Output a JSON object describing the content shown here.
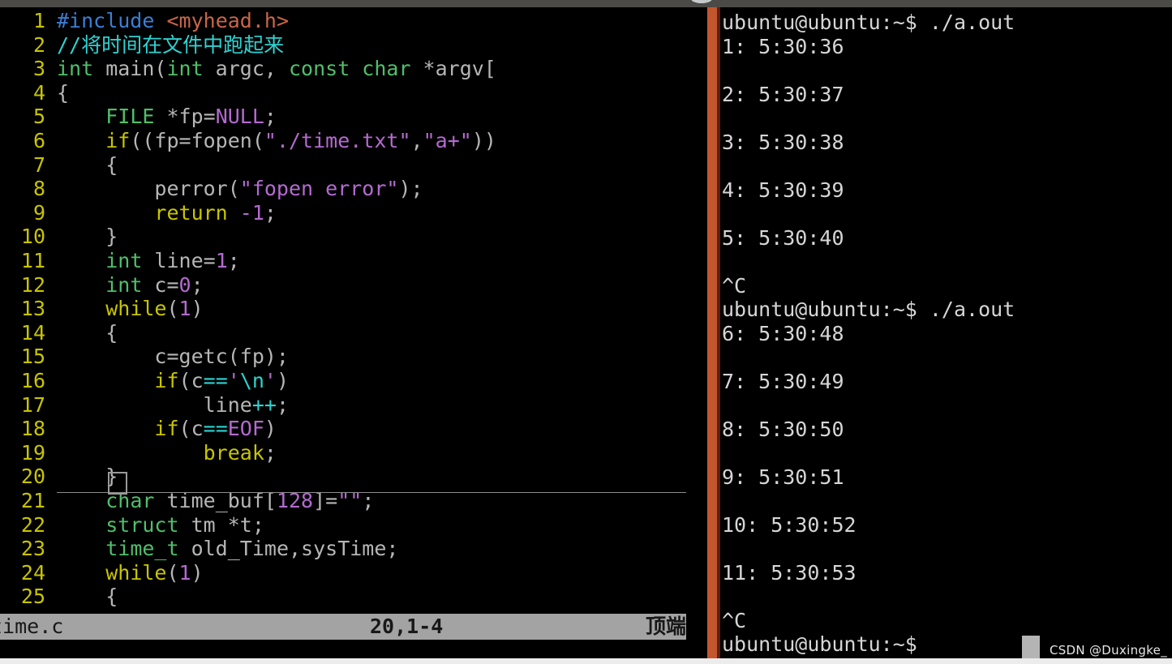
{
  "window": {
    "titlebar_color": "#4c4a46",
    "divider_color": "#c4562e",
    "background": "#000000"
  },
  "editor": {
    "app": "vim",
    "filename": "time.c",
    "cursor_line": 20,
    "cursor_column_display": "20,1-4",
    "scroll_position_label": "顶端",
    "first_visible_line": 1,
    "last_visible_line": 25,
    "lines": [
      {
        "n": "1",
        "tokens": [
          {
            "t": "#include",
            "c": "c-pre"
          },
          {
            "t": " ",
            "c": "c-plain"
          },
          {
            "t": "<myhead.h>",
            "c": "c-inc"
          }
        ]
      },
      {
        "n": "2",
        "tokens": [
          {
            "t": "//将时间在文件中跑起来",
            "c": "c-cmt"
          }
        ]
      },
      {
        "n": "3",
        "tokens": [
          {
            "t": "int",
            "c": "c-type"
          },
          {
            "t": " main(",
            "c": "c-plain"
          },
          {
            "t": "int",
            "c": "c-type"
          },
          {
            "t": " argc, ",
            "c": "c-plain"
          },
          {
            "t": "const char",
            "c": "c-type"
          },
          {
            "t": " *argv[",
            "c": "c-plain"
          }
        ]
      },
      {
        "n": "4",
        "tokens": [
          {
            "t": "{",
            "c": "c-plain"
          }
        ]
      },
      {
        "n": "5",
        "tokens": [
          {
            "t": "    ",
            "c": "c-plain"
          },
          {
            "t": "FILE",
            "c": "c-type"
          },
          {
            "t": " *fp=",
            "c": "c-plain"
          },
          {
            "t": "NULL",
            "c": "c-cnst"
          },
          {
            "t": ";",
            "c": "c-plain"
          }
        ]
      },
      {
        "n": "6",
        "tokens": [
          {
            "t": "    ",
            "c": "c-plain"
          },
          {
            "t": "if",
            "c": "c-kw"
          },
          {
            "t": "((fp=fopen(",
            "c": "c-plain"
          },
          {
            "t": "\"./time.txt\"",
            "c": "c-str"
          },
          {
            "t": ",",
            "c": "c-plain"
          },
          {
            "t": "\"a+\"",
            "c": "c-str"
          },
          {
            "t": "))",
            "c": "c-plain"
          }
        ]
      },
      {
        "n": "7",
        "tokens": [
          {
            "t": "    {",
            "c": "c-plain"
          }
        ]
      },
      {
        "n": "8",
        "tokens": [
          {
            "t": "        perror(",
            "c": "c-plain"
          },
          {
            "t": "\"fopen error\"",
            "c": "c-str"
          },
          {
            "t": ");",
            "c": "c-plain"
          }
        ]
      },
      {
        "n": "9",
        "tokens": [
          {
            "t": "        ",
            "c": "c-plain"
          },
          {
            "t": "return",
            "c": "c-kw"
          },
          {
            "t": " ",
            "c": "c-plain"
          },
          {
            "t": "-1",
            "c": "c-num"
          },
          {
            "t": ";",
            "c": "c-plain"
          }
        ]
      },
      {
        "n": "10",
        "tokens": [
          {
            "t": "    }",
            "c": "c-plain"
          }
        ]
      },
      {
        "n": "11",
        "tokens": [
          {
            "t": "    ",
            "c": "c-plain"
          },
          {
            "t": "int",
            "c": "c-type"
          },
          {
            "t": " line=",
            "c": "c-plain"
          },
          {
            "t": "1",
            "c": "c-num"
          },
          {
            "t": ";",
            "c": "c-plain"
          }
        ]
      },
      {
        "n": "12",
        "tokens": [
          {
            "t": "    ",
            "c": "c-plain"
          },
          {
            "t": "int",
            "c": "c-type"
          },
          {
            "t": " c=",
            "c": "c-plain"
          },
          {
            "t": "0",
            "c": "c-num"
          },
          {
            "t": ";",
            "c": "c-plain"
          }
        ]
      },
      {
        "n": "13",
        "tokens": [
          {
            "t": "    ",
            "c": "c-plain"
          },
          {
            "t": "while",
            "c": "c-kw"
          },
          {
            "t": "(",
            "c": "c-plain"
          },
          {
            "t": "1",
            "c": "c-num"
          },
          {
            "t": ")",
            "c": "c-plain"
          }
        ]
      },
      {
        "n": "14",
        "tokens": [
          {
            "t": "    {",
            "c": "c-plain"
          }
        ]
      },
      {
        "n": "15",
        "tokens": [
          {
            "t": "        c=getc(fp);",
            "c": "c-plain"
          }
        ]
      },
      {
        "n": "16",
        "tokens": [
          {
            "t": "        ",
            "c": "c-plain"
          },
          {
            "t": "if",
            "c": "c-kw"
          },
          {
            "t": "(c",
            "c": "c-plain"
          },
          {
            "t": "==",
            "c": "c-op"
          },
          {
            "t": "'",
            "c": "c-str"
          },
          {
            "t": "\\n",
            "c": "c-op"
          },
          {
            "t": "'",
            "c": "c-str"
          },
          {
            "t": ")",
            "c": "c-plain"
          }
        ]
      },
      {
        "n": "17",
        "tokens": [
          {
            "t": "            line",
            "c": "c-plain"
          },
          {
            "t": "++",
            "c": "c-op"
          },
          {
            "t": ";",
            "c": "c-plain"
          }
        ]
      },
      {
        "n": "18",
        "tokens": [
          {
            "t": "        ",
            "c": "c-plain"
          },
          {
            "t": "if",
            "c": "c-kw"
          },
          {
            "t": "(c",
            "c": "c-plain"
          },
          {
            "t": "==",
            "c": "c-op"
          },
          {
            "t": "EOF",
            "c": "c-cnst"
          },
          {
            "t": ")",
            "c": "c-plain"
          }
        ]
      },
      {
        "n": "19",
        "tokens": [
          {
            "t": "            ",
            "c": "c-plain"
          },
          {
            "t": "break",
            "c": "c-kw"
          },
          {
            "t": ";",
            "c": "c-plain"
          }
        ]
      },
      {
        "n": "20",
        "tokens": [
          {
            "t": "    }",
            "c": "c-plain"
          }
        ]
      },
      {
        "n": "21",
        "tokens": [
          {
            "t": "    ",
            "c": "c-plain"
          },
          {
            "t": "char",
            "c": "c-type"
          },
          {
            "t": " time_buf[",
            "c": "c-plain"
          },
          {
            "t": "128",
            "c": "c-num"
          },
          {
            "t": "]=",
            "c": "c-plain"
          },
          {
            "t": "\"\"",
            "c": "c-str"
          },
          {
            "t": ";",
            "c": "c-plain"
          }
        ]
      },
      {
        "n": "22",
        "tokens": [
          {
            "t": "    ",
            "c": "c-plain"
          },
          {
            "t": "struct",
            "c": "c-type"
          },
          {
            "t": " tm *t;",
            "c": "c-plain"
          }
        ]
      },
      {
        "n": "23",
        "tokens": [
          {
            "t": "    ",
            "c": "c-plain"
          },
          {
            "t": "time_t",
            "c": "c-type"
          },
          {
            "t": " old_Time,sysTime;",
            "c": "c-plain"
          }
        ]
      },
      {
        "n": "24",
        "tokens": [
          {
            "t": "    ",
            "c": "c-plain"
          },
          {
            "t": "while",
            "c": "c-kw"
          },
          {
            "t": "(",
            "c": "c-plain"
          },
          {
            "t": "1",
            "c": "c-num"
          },
          {
            "t": ")",
            "c": "c-plain"
          }
        ]
      },
      {
        "n": "25",
        "tokens": [
          {
            "t": "    {",
            "c": "c-plain"
          }
        ]
      }
    ]
  },
  "terminal": {
    "prompt": "ubuntu@ubuntu:~$",
    "command": "./a.out",
    "lines": [
      "ubuntu@ubuntu:~$ ./a.out",
      "1: 5:30:36",
      "",
      "2: 5:30:37",
      "",
      "3: 5:30:38",
      "",
      "4: 5:30:39",
      "",
      "5: 5:30:40",
      "",
      "^C",
      "ubuntu@ubuntu:~$ ./a.out",
      "6: 5:30:48",
      "",
      "7: 5:30:49",
      "",
      "8: 5:30:50",
      "",
      "9: 5:30:51",
      "",
      "10: 5:30:52",
      "",
      "11: 5:30:53",
      "",
      "^C",
      "ubuntu@ubuntu:~$ "
    ]
  },
  "watermark": {
    "text": "CSDN @Duxingke_"
  }
}
